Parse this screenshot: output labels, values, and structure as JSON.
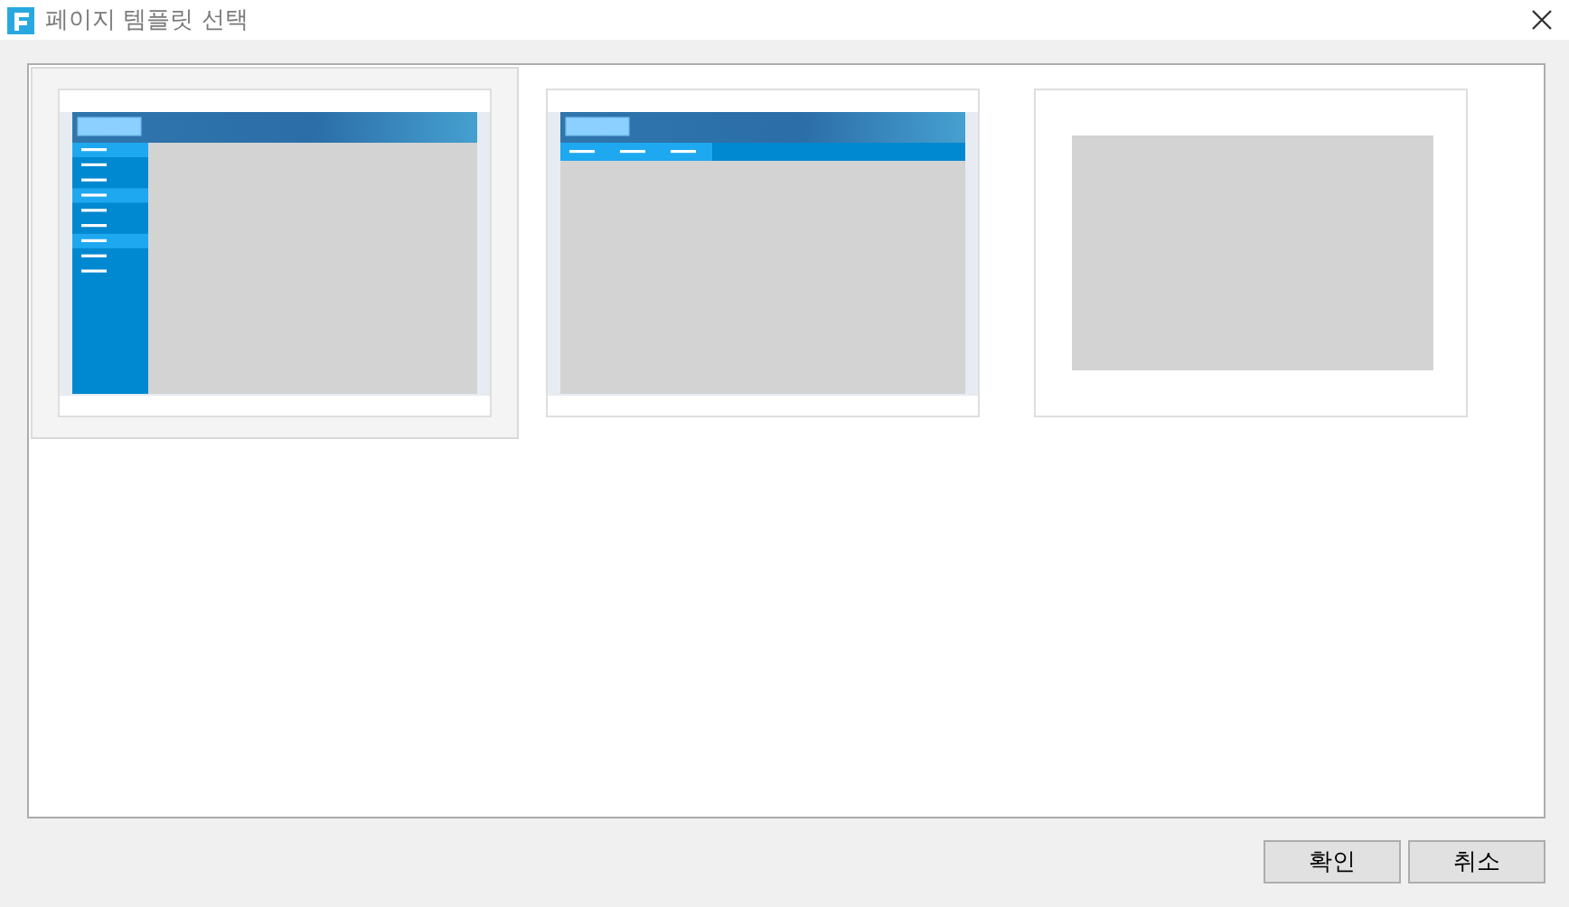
{
  "window": {
    "title": "페이지 템플릿 선택"
  },
  "templates": [
    {
      "kind": "sidebar",
      "selected": true
    },
    {
      "kind": "topnav",
      "selected": false
    },
    {
      "kind": "blank",
      "selected": false
    }
  ],
  "buttons": [
    {
      "label": "확인"
    },
    {
      "label": "취소"
    }
  ]
}
